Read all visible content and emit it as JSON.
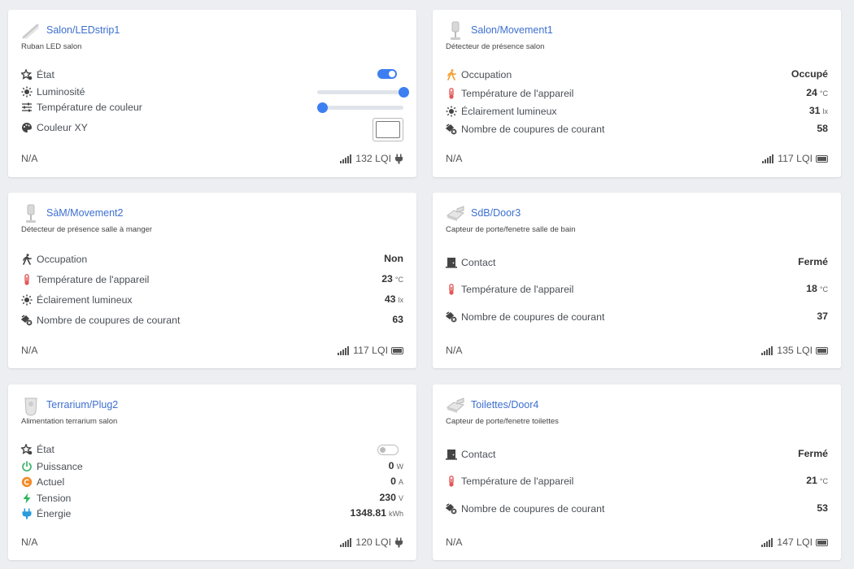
{
  "colors": {
    "accent": "#3d7ff0",
    "link": "#3d6fd0",
    "temp": "#e45757",
    "occupied": "#f0a030",
    "power": "#3bb56a",
    "current": "#f28c28",
    "voltage": "#2ab55a",
    "energy": "#2b9bdc"
  },
  "cards": [
    {
      "title": "Salon/LEDstrip1",
      "desc": "Ruban LED salon",
      "rows": [
        {
          "label": "État",
          "icon": "star-toggle-icon"
        },
        {
          "label": "Luminosité",
          "icon": "brightness-icon"
        },
        {
          "label": "Température de couleur",
          "icon": "sliders-icon"
        },
        {
          "label": "Couleur XY",
          "icon": "palette-icon"
        }
      ],
      "controls": {
        "state_on": true,
        "brightness": 1.0,
        "color_temp": 0.0
      },
      "footer": {
        "status": "N/A",
        "lqi": "132 LQI",
        "power_source": "plug-icon"
      }
    },
    {
      "title": "Salon/Movement1",
      "desc": "Détecteur de présence salon",
      "rows": [
        {
          "label": "Occupation",
          "value": "Occupé",
          "unit": "",
          "icon": "walking-person-icon"
        },
        {
          "label": "Température de l'appareil",
          "value": "24",
          "unit": "°C",
          "icon": "thermometer-icon"
        },
        {
          "label": "Éclairement lumineux",
          "value": "31",
          "unit": "lx",
          "icon": "brightness-icon"
        },
        {
          "label": "Nombre de coupures de courant",
          "value": "58",
          "unit": "",
          "icon": "plug-off-icon"
        }
      ],
      "footer": {
        "status": "N/A",
        "lqi": "117 LQI",
        "power_source": "battery-icon"
      }
    },
    {
      "title": "SàM/Movement2",
      "desc": "Détecteur de présence salle à manger",
      "rows": [
        {
          "label": "Occupation",
          "value": "Non",
          "unit": "",
          "icon": "walking-person-icon"
        },
        {
          "label": "Température de l'appareil",
          "value": "23",
          "unit": "°C",
          "icon": "thermometer-icon"
        },
        {
          "label": "Éclairement lumineux",
          "value": "43",
          "unit": "lx",
          "icon": "brightness-icon"
        },
        {
          "label": "Nombre de coupures de courant",
          "value": "63",
          "unit": "",
          "icon": "plug-off-icon"
        }
      ],
      "footer": {
        "status": "N/A",
        "lqi": "117 LQI",
        "power_source": "battery-icon"
      }
    },
    {
      "title": "SdB/Door3",
      "desc": "Capteur de porte/fenetre salle de bain",
      "rows": [
        {
          "label": "Contact",
          "value": "Fermé",
          "unit": "",
          "icon": "door-icon"
        },
        {
          "label": "Température de l'appareil",
          "value": "18",
          "unit": "°C",
          "icon": "thermometer-icon"
        },
        {
          "label": "Nombre de coupures de courant",
          "value": "37",
          "unit": "",
          "icon": "plug-off-icon"
        }
      ],
      "footer": {
        "status": "N/A",
        "lqi": "135 LQI",
        "power_source": "battery-icon"
      }
    },
    {
      "title": "Terrarium/Plug2",
      "desc": "Alimentation terrarium salon",
      "rows": [
        {
          "label": "État",
          "icon": "star-toggle-icon"
        },
        {
          "label": "Puissance",
          "value": "0",
          "unit": "W",
          "icon": "power-icon"
        },
        {
          "label": "Actuel",
          "value": "0",
          "unit": "A",
          "icon": "current-icon"
        },
        {
          "label": "Tension",
          "value": "230",
          "unit": "V",
          "icon": "lightning-icon"
        },
        {
          "label": "Énergie",
          "value": "1348.81",
          "unit": "kWh",
          "icon": "energy-plug-icon"
        }
      ],
      "controls": {
        "state_on": false
      },
      "footer": {
        "status": "N/A",
        "lqi": "120 LQI",
        "power_source": "plug-icon"
      }
    },
    {
      "title": "Toilettes/Door4",
      "desc": "Capteur de porte/fenetre toilettes",
      "rows": [
        {
          "label": "Contact",
          "value": "Fermé",
          "unit": "",
          "icon": "door-icon"
        },
        {
          "label": "Température de l'appareil",
          "value": "21",
          "unit": "°C",
          "icon": "thermometer-icon"
        },
        {
          "label": "Nombre de coupures de courant",
          "value": "53",
          "unit": "",
          "icon": "plug-off-icon"
        }
      ],
      "footer": {
        "status": "N/A",
        "lqi": "147 LQI",
        "power_source": "battery-icon"
      }
    }
  ]
}
